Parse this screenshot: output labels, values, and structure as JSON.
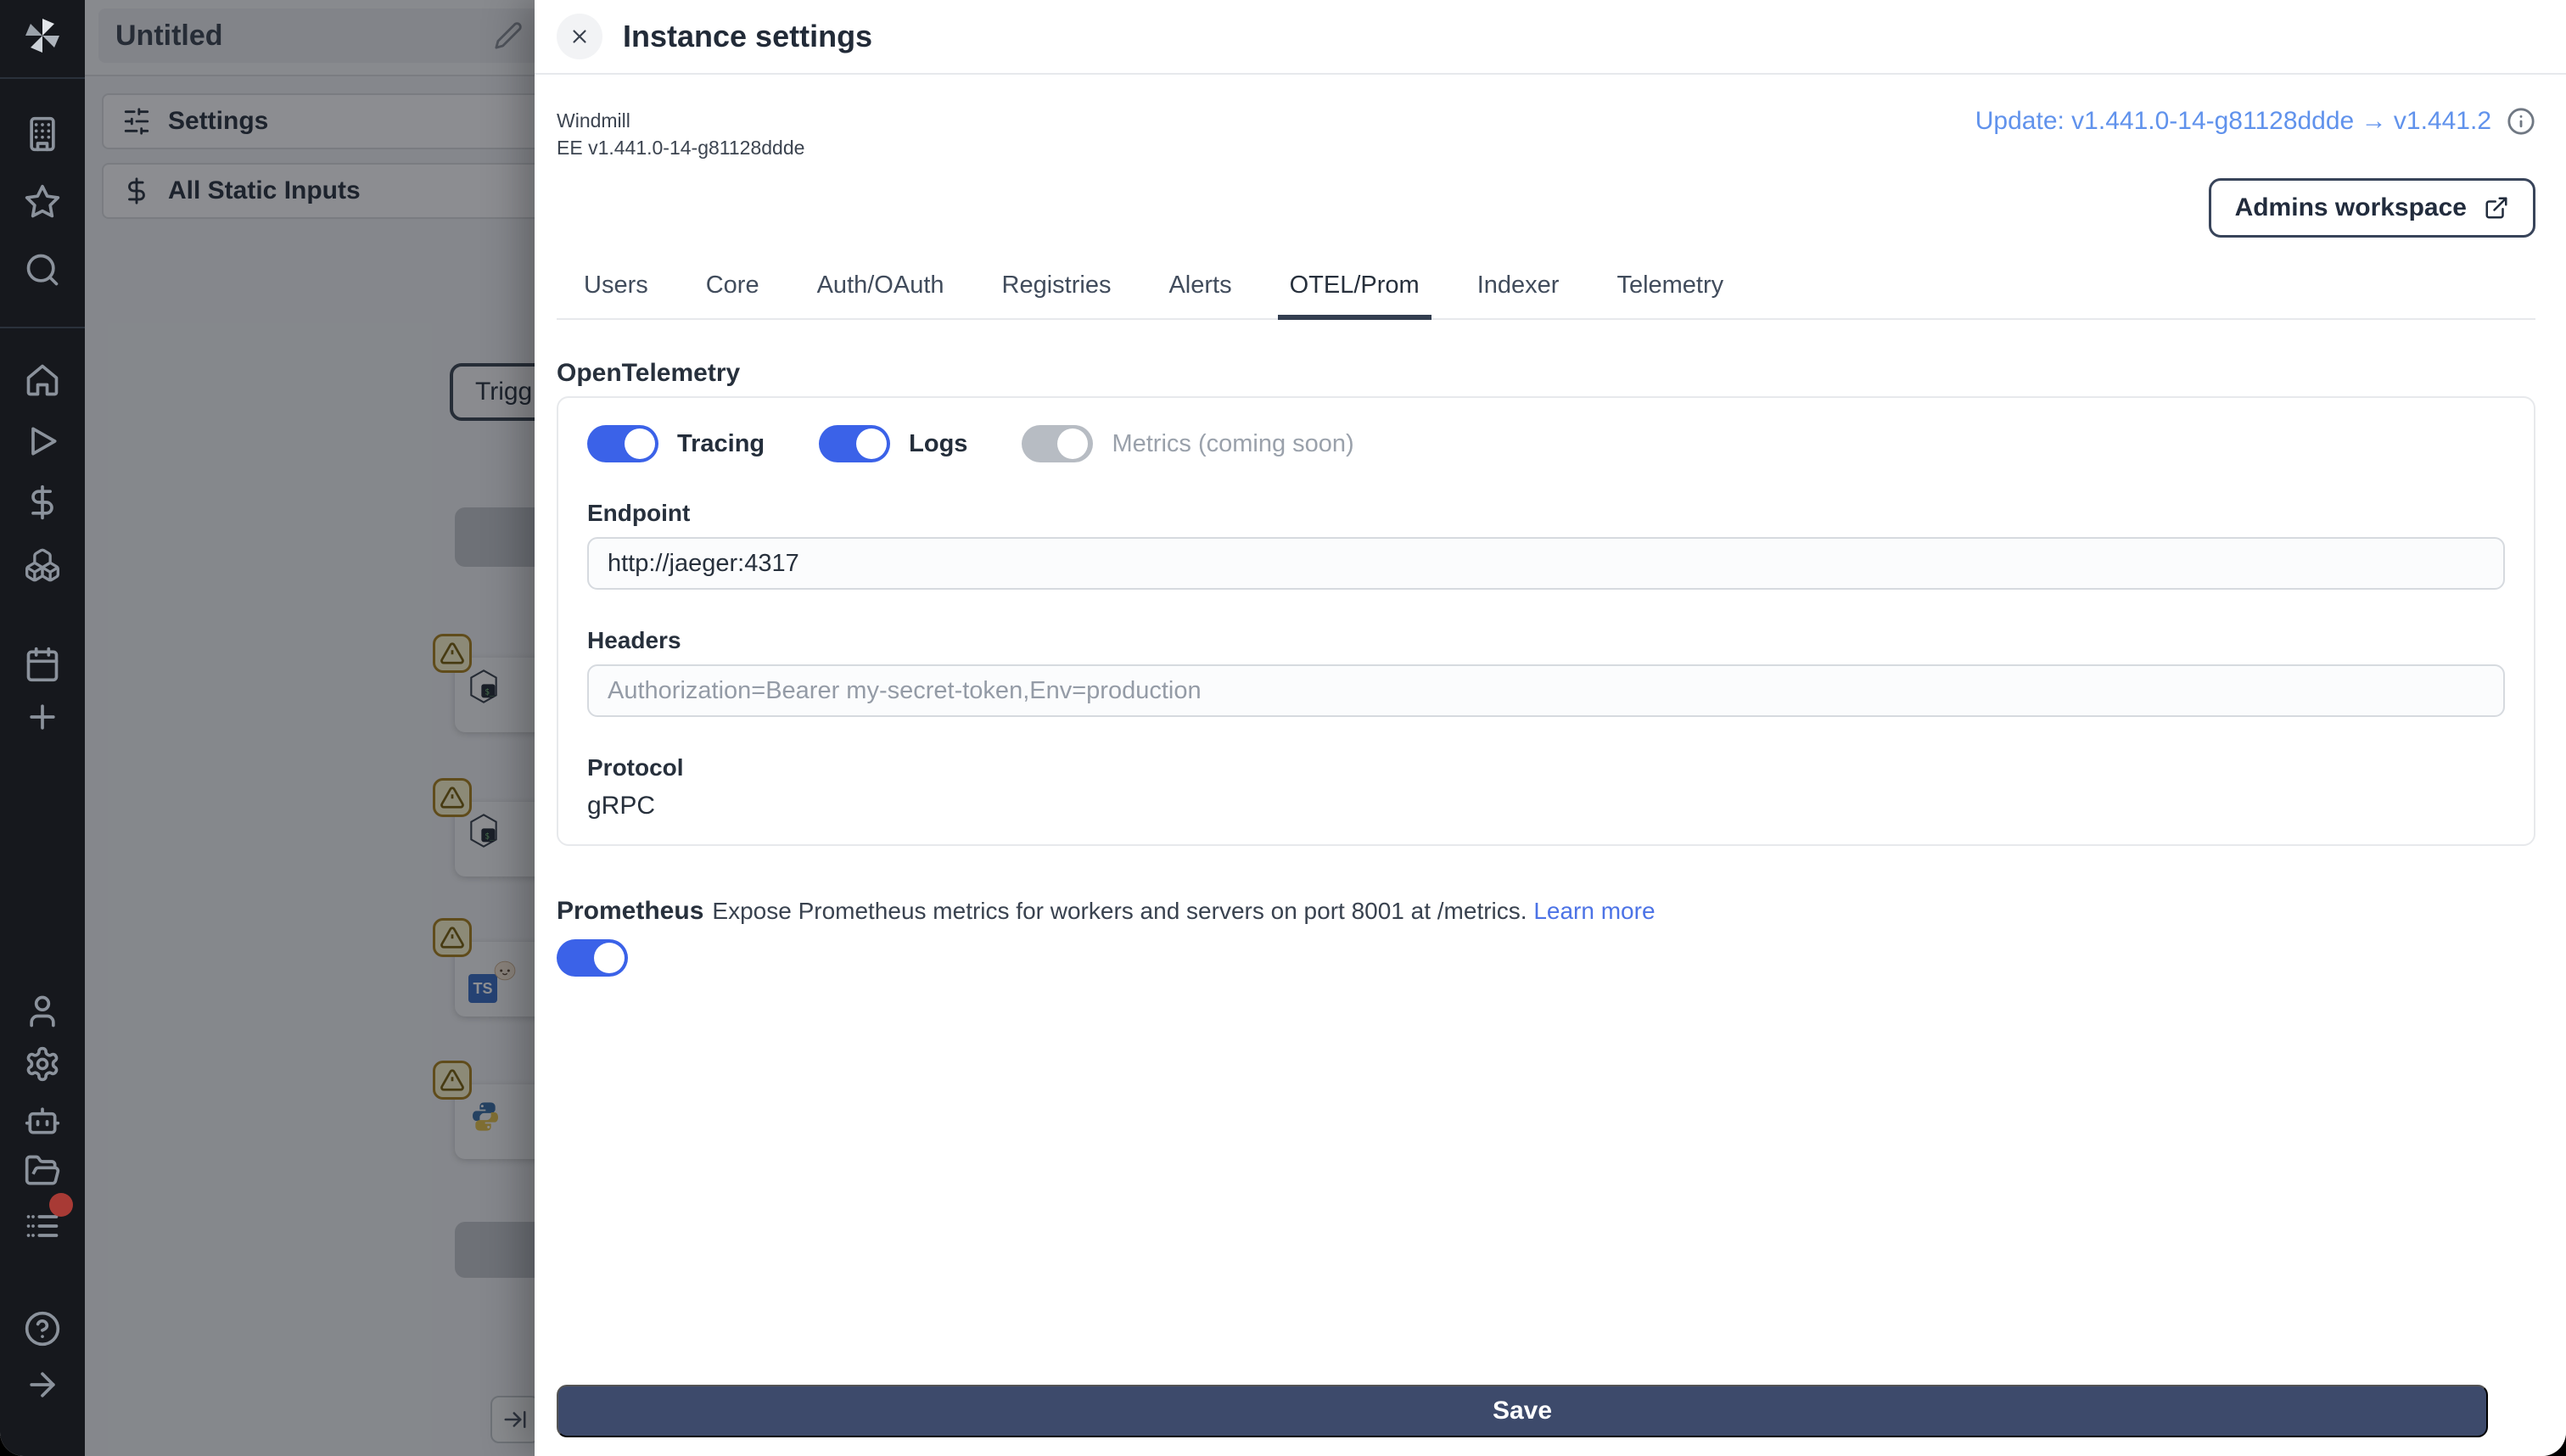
{
  "sidebar": {
    "logo": "windmill-logo",
    "icon_names": [
      "building",
      "star",
      "search",
      "home",
      "play",
      "dollar-sign",
      "boxes",
      "calendar",
      "plus",
      "user",
      "gear",
      "robot",
      "folder-open",
      "list",
      "help-circle",
      "arrow-right"
    ],
    "notification_color": "#a83a35"
  },
  "flow": {
    "title": "Untitled",
    "settings_label": "Settings",
    "static_inputs_label": "All Static Inputs",
    "trigger_label": "Trigg"
  },
  "drawer": {
    "title": "Instance settings",
    "app_name": "Windmill",
    "version": "EE v1.441.0-14-g81128ddde",
    "update_link": "Update: v1.441.0-14-g81128ddde → v1.441.2",
    "workspace_button": "Admins workspace",
    "tabs": [
      "Users",
      "Core",
      "Auth/OAuth",
      "Registries",
      "Alerts",
      "OTEL/Prom",
      "Indexer",
      "Telemetry"
    ],
    "active_tab": "OTEL/Prom",
    "otel": {
      "heading": "OpenTelemetry",
      "toggles": [
        {
          "label": "Tracing",
          "on": true
        },
        {
          "label": "Logs",
          "on": true
        },
        {
          "label": "Metrics (coming soon)",
          "on": false,
          "disabled": true
        }
      ],
      "endpoint_label": "Endpoint",
      "endpoint_value": "http://jaeger:4317",
      "headers_label": "Headers",
      "headers_placeholder": "Authorization=Bearer my-secret-token,Env=production",
      "protocol_label": "Protocol",
      "protocol_value": "gRPC"
    },
    "prometheus": {
      "heading": "Prometheus",
      "description": "Expose Prometheus metrics for workers and servers on port 8001 at /metrics.",
      "learn_more": "Learn more",
      "enabled": true
    },
    "save_label": "Save"
  },
  "colors": {
    "toggle_on": "#3b62e8",
    "toggle_off": "#b7bcc3",
    "save_button": "#3d4a6b",
    "update_link": "#6092ec",
    "learn_more_link": "#4c73e6",
    "active_tab_underline": "#333e50",
    "warning_border": "#a8801f",
    "sidebar_bg": "#16181d",
    "notification_dot": "#a83a35"
  }
}
